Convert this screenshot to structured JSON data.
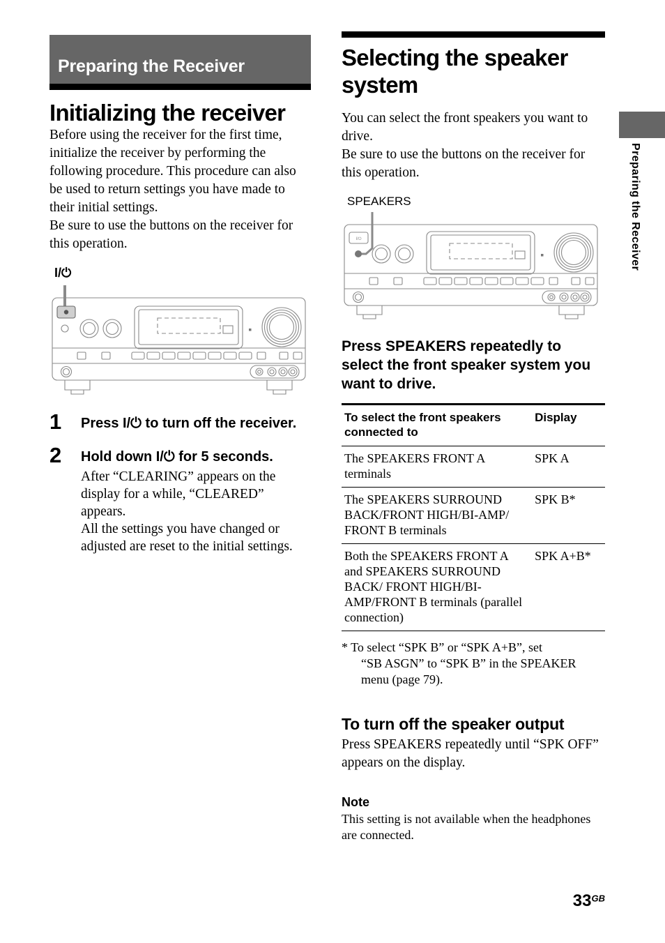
{
  "chapter": {
    "banner_title": "Preparing the Receiver",
    "side_tab_text": "Preparing the Receiver",
    "banner_bg": "#666666"
  },
  "left_column": {
    "title": "Initializing the receiver",
    "intro": "Before using the receiver for the first time, initialize the receiver by performing the following procedure. This procedure can also be used to return settings you have made to their initial settings.",
    "intro2": "Be sure to use the buttons on the receiver for this operation.",
    "diagram": {
      "callout_label": "I/⏻",
      "alt": "front panel of receiver with power button highlighted"
    },
    "steps": [
      {
        "number": "1",
        "heading": "Press I/⏻ to turn off the receiver.",
        "body": ""
      },
      {
        "number": "2",
        "heading": "Hold down I/⏻ for 5 seconds.",
        "body": "After “CLEARING” appears on the display for a while, “CLEARED” appears.\nAll the settings you have changed or adjusted are reset to the initial settings."
      }
    ]
  },
  "right_column": {
    "title": "Selecting the speaker system",
    "intro": "You can select the front speakers you want to drive.",
    "intro2": "Be sure to use the buttons on the receiver for this operation.",
    "diagram": {
      "callout_label": "SPEAKERS",
      "power_button_label": "I/⏻",
      "alt": "front panel of receiver with SPEAKERS button highlighted"
    },
    "lead_bold": "Press SPEAKERS repeatedly to select the front speaker system you want to drive.",
    "table": {
      "headers": [
        "To select the front speakers connected to",
        "Display"
      ],
      "rows": [
        {
          "select": "The SPEAKERS FRONT A terminals",
          "display": "SPK A"
        },
        {
          "select": "The SPEAKERS SURROUND BACK/FRONT HIGH/BI-AMP/ FRONT B terminals",
          "display": "SPK B*"
        },
        {
          "select": "Both the SPEAKERS FRONT A and SPEAKERS SURROUND BACK/ FRONT HIGH/BI-AMP/FRONT B terminals (parallel connection)",
          "display": "SPK A+B*"
        }
      ]
    },
    "footnote_line1": "* To select “SPK B” or “SPK A+B”, set",
    "footnote_line2": "“SB ASGN” to “SPK B” in the SPEAKER menu (page 79).",
    "subsection": {
      "heading": "To turn off the speaker output",
      "body": "Press SPEAKERS repeatedly until “SPK OFF” appears on the display."
    },
    "note": {
      "heading": "Note",
      "body": "This setting is not available when the headphones are connected."
    }
  },
  "footer": {
    "page_number": "33",
    "page_suffix": "GB"
  }
}
